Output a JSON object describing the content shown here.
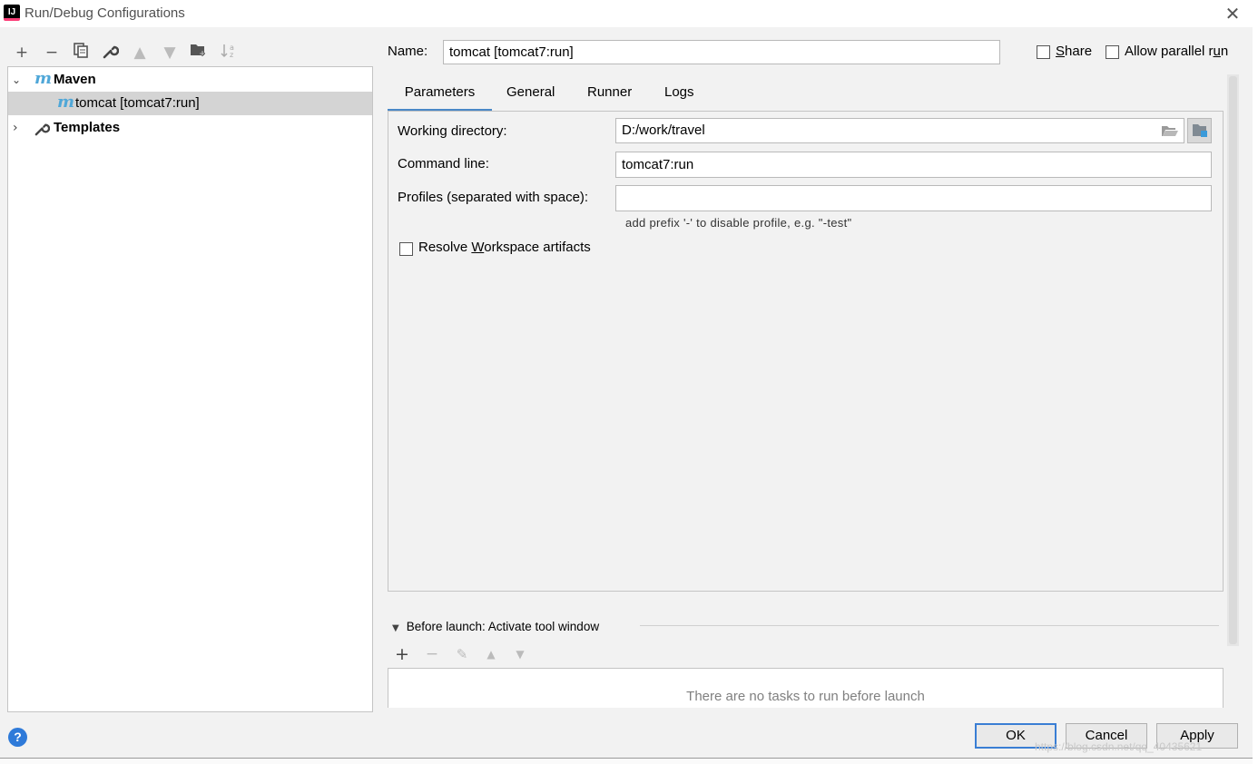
{
  "window": {
    "title": "Run/Debug Configurations",
    "app_icon": "intellij-idea-icon",
    "close_glyph": "✕"
  },
  "toolbar": {
    "icons": [
      "add-icon",
      "remove-icon",
      "copy-icon",
      "wrench-icon",
      "move-up-icon",
      "move-down-icon",
      "new-folder-icon",
      "sort-icon"
    ]
  },
  "tree": {
    "maven_label": "Maven",
    "maven_icon_glyph": "m",
    "config_label": "tomcat [tomcat7:run]",
    "templates_label": "Templates"
  },
  "config": {
    "name_label": "Name:",
    "name_value": "tomcat [tomcat7:run]",
    "share_label_pre": "",
    "share_mnemonic": "S",
    "share_label_post": "hare",
    "share_checked": false,
    "parallel_label_pre": "Allow parallel r",
    "parallel_mnemonic": "u",
    "parallel_label_post": "n",
    "parallel_checked": false
  },
  "tabs": [
    "Parameters",
    "General",
    "Runner",
    "Logs"
  ],
  "active_tab": "Parameters",
  "parameters": {
    "working_dir_label": "Working directory:",
    "working_dir_value": "D:/work/travel",
    "command_line_label": "Command line:",
    "command_line_value": "tomcat7:run",
    "profiles_label": "Profiles (separated with space):",
    "profiles_value": "",
    "profiles_hint": "add prefix '-' to disable profile, e.g. \"-test\"",
    "resolve_label_pre": "Resolve ",
    "resolve_mnemonic": "W",
    "resolve_label_post": "orkspace artifacts",
    "resolve_checked": false
  },
  "before_launch": {
    "header": "Before launch: Activate tool window",
    "empty_text": "There are no tasks to run before launch"
  },
  "buttons": {
    "ok": "OK",
    "cancel": "Cancel",
    "apply": "Apply",
    "help_glyph": "?"
  },
  "watermark": "https://blog.csdn.net/qq_40435621",
  "colors": {
    "accent": "#4a88c7",
    "maven": "#4fa7d8",
    "selection": "#d4d4d4"
  }
}
